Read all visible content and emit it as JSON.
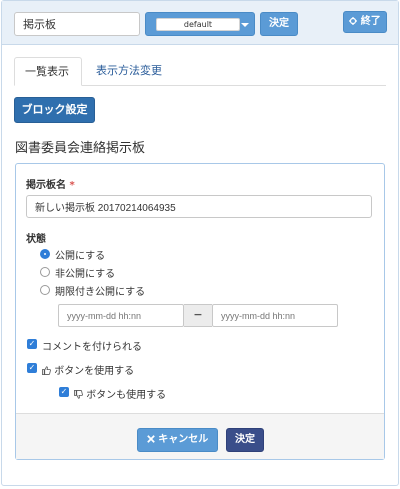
{
  "topbar": {
    "name_value": "掲示板",
    "frame_select": "default",
    "decide_label": "決定",
    "close_label": "終了",
    "close_icon": "gear-icon"
  },
  "tabs": [
    {
      "label": "一覧表示",
      "active": true
    },
    {
      "label": "表示方法変更",
      "active": false
    }
  ],
  "block_settings_label": "ブロック設定",
  "page_title": "図書委員会連絡掲示板",
  "form": {
    "board_name_label": "掲示板名",
    "required_mark": "*",
    "board_name_value": "新しい掲示板 20170214064935",
    "status_label": "状態",
    "status_options": [
      {
        "label": "公開にする",
        "selected": true
      },
      {
        "label": "非公開にする",
        "selected": false
      },
      {
        "label": "期限付き公開にする",
        "selected": false
      }
    ],
    "date_start_placeholder": "yyyy-mm-dd hh:nn",
    "date_separator": "−",
    "date_end_placeholder": "yyyy-mm-dd hh:nn",
    "allow_comments_label": "コメントを付けられる",
    "use_like_label": "ボタンを使用する",
    "use_unlike_label": "ボタンも使用する",
    "like_icon": "thumbs-up-icon",
    "unlike_icon": "thumbs-down-icon"
  },
  "footer": {
    "cancel_label": "キャンセル",
    "cancel_icon": "close-icon",
    "decide_label": "決定"
  },
  "colors": {
    "primary": "#5b9bd6",
    "dark_primary": "#2f6fae",
    "decide": "#3a4e8a",
    "panel_border": "#a8c8e8"
  }
}
